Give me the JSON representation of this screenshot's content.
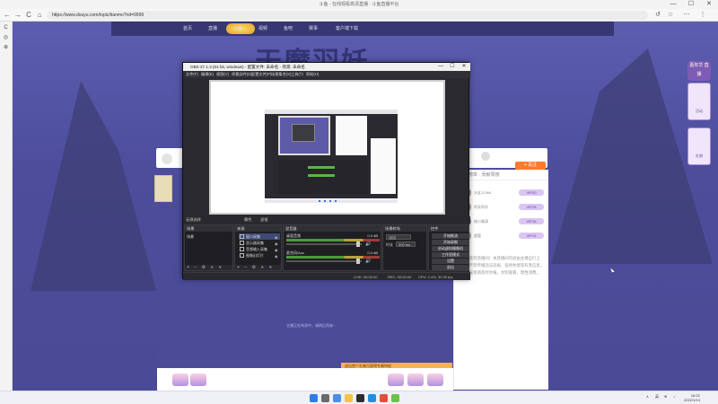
{
  "browser": {
    "window_title": "斗鱼 - 在线观看高清直播 · 斗鱼直播平台",
    "url": "https://www.douyu.com/topic/tianmo?rid=9999",
    "back": "←",
    "forward": "→",
    "reload": "C",
    "home": "⌂",
    "minimize": "—",
    "maximize": "☐",
    "close": "✕",
    "menu": "⋮",
    "ext_icons": [
      "↺",
      "☆",
      "⋯"
    ],
    "side_icons": [
      "C",
      "◎",
      "⊕"
    ]
  },
  "site": {
    "nav_items": [
      "首页",
      "直播",
      "分类",
      "视频",
      "鱼吧",
      "赛事",
      "客户端下载"
    ],
    "banner_text": "天魔羽妖",
    "right_badge": "嘉年华 直播",
    "right_cards": [
      "活动",
      "礼物"
    ],
    "follow_label": "+ 关注",
    "chat_tabs": "主播榜单 · 贡献周榜",
    "users": [
      {
        "name": "水友12366",
        "tag": "VIP20"
      },
      {
        "name": "阿呆同学",
        "tag": "VIP18"
      },
      {
        "name": "绫小路清",
        "tag": "VIP16"
      },
      {
        "name": "超管",
        "tag": "VIP12"
      }
    ],
    "chat_text": "欢迎来到直播间！本直播间内容由主播自行上传，严禁传播违法违规、低俗色情等有害信息，如有发现请及时举报。文明观看，理性消费。",
    "empty_text": "主播正在休息中，请稍后再来~",
    "orange_text": "送出首个礼物可获得专属特权",
    "gift_labels": [
      "荧光棒",
      "办卡",
      "飞机"
    ]
  },
  "obs": {
    "title": "OBS 27.1.3 (64 bit, windows) - 配置文件: 未命名 - 场景: 未命名",
    "menu": [
      "文件(F)",
      "编辑(E)",
      "视图(V)",
      "停靠部件(D)",
      "配置文件(P)",
      "场景集合(S)",
      "工具(T)",
      "帮助(H)"
    ],
    "toolbar_row": [
      "无源选择",
      "属性",
      "滤镜"
    ],
    "docks": {
      "scenes": "场景",
      "scene_item": "场景",
      "sources": "来源",
      "source_items": [
        "窗口采集",
        "显示器采集",
        "音频输入采集",
        "图像幻灯片"
      ],
      "mixer": "混音器",
      "mixer_channels": [
        {
          "label": "桌面音频",
          "db": "0.0 dB"
        },
        {
          "label": "麦克风/Aux",
          "db": "0.0 dB"
        }
      ],
      "transitions": "场景转场",
      "transition_type": "淡出",
      "duration_label": "时长",
      "duration_value": "300 ms",
      "controls": "控件",
      "control_buttons": [
        "开始推流",
        "开始录制",
        "启动虚拟摄像机",
        "工作室模式",
        "设置",
        "退出"
      ],
      "dock_foot": "+ − ⚙ ∧ ∨"
    },
    "status": [
      "LIVE: 00:00:00",
      "REC: 00:00:00",
      "CPU: 2.4%, 30.00 fps"
    ]
  },
  "taskbar": {
    "tray": [
      "∧",
      "英",
      "⊕",
      "♪"
    ],
    "time": "16:22",
    "date": "2022/1/14"
  },
  "colors": {
    "accent": "#ff7a2b",
    "page_bg": "#4d4d9c",
    "obs_bg": "#2a2a2e",
    "vip": "#d9c6f2"
  }
}
